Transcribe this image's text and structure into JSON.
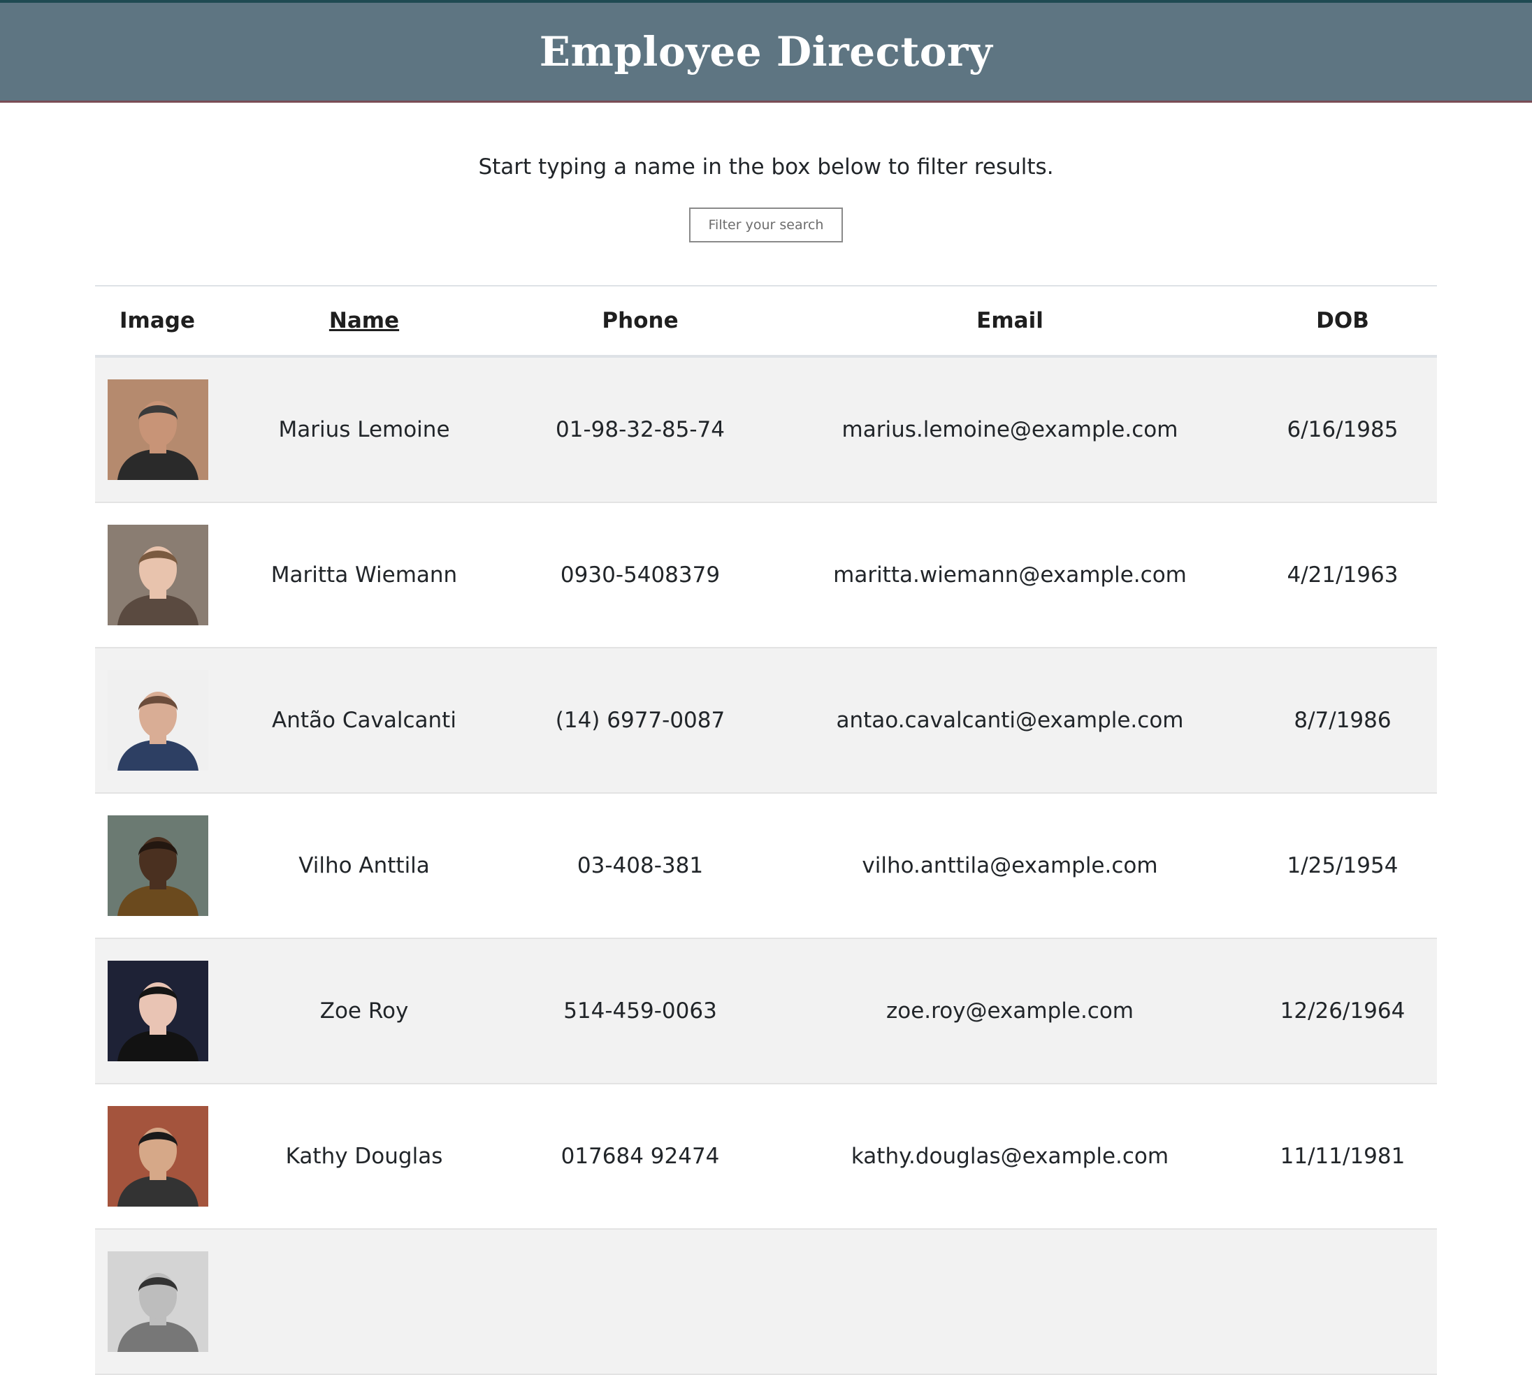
{
  "header": {
    "title": "Employee Directory"
  },
  "intro": {
    "text": "Start typing a name in the box below to filter results."
  },
  "search": {
    "placeholder": "Filter your search",
    "value": ""
  },
  "table": {
    "headers": [
      "Image",
      "Name",
      "Phone",
      "Email",
      "DOB"
    ],
    "rows": [
      {
        "name": "Marius Lemoine",
        "phone": "01-98-32-85-74",
        "email": "marius.lemoine@example.com",
        "dob": "6/16/1985",
        "bg": "#b58a6e",
        "skin": "#c89477",
        "hair": "#3a3a3a",
        "shirt": "#2a2a2a"
      },
      {
        "name": "Maritta Wiemann",
        "phone": "0930-5408379",
        "email": "maritta.wiemann@example.com",
        "dob": "4/21/1963",
        "bg": "#8a7d72",
        "skin": "#e8c3ad",
        "hair": "#7a5a40",
        "shirt": "#5a4a40"
      },
      {
        "name": "Antão Cavalcanti",
        "phone": "(14) 6977-0087",
        "email": "antao.cavalcanti@example.com",
        "dob": "8/7/1986",
        "bg": "#f0f0f0",
        "skin": "#d9ad95",
        "hair": "#6b4c3b",
        "shirt": "#2d3f63"
      },
      {
        "name": "Vilho Anttila",
        "phone": "03-408-381",
        "email": "vilho.anttila@example.com",
        "dob": "1/25/1954",
        "bg": "#6b7a72",
        "skin": "#4a3020",
        "hair": "#231710",
        "shirt": "#6b4a1e"
      },
      {
        "name": "Zoe Roy",
        "phone": "514-459-0063",
        "email": "zoe.roy@example.com",
        "dob": "12/26/1964",
        "bg": "#1e2236",
        "skin": "#e9c4b4",
        "hair": "#141414",
        "shirt": "#121212"
      },
      {
        "name": "Kathy Douglas",
        "phone": "017684 92474",
        "email": "kathy.douglas@example.com",
        "dob": "11/11/1981",
        "bg": "#a4543d",
        "skin": "#d6a888",
        "hair": "#1a1a1a",
        "shirt": "#333333"
      },
      {
        "name": "",
        "phone": "",
        "email": "",
        "dob": "",
        "bg": "#d4d4d4",
        "skin": "#bdbdbd",
        "hair": "#333333",
        "shirt": "#777777"
      }
    ]
  }
}
